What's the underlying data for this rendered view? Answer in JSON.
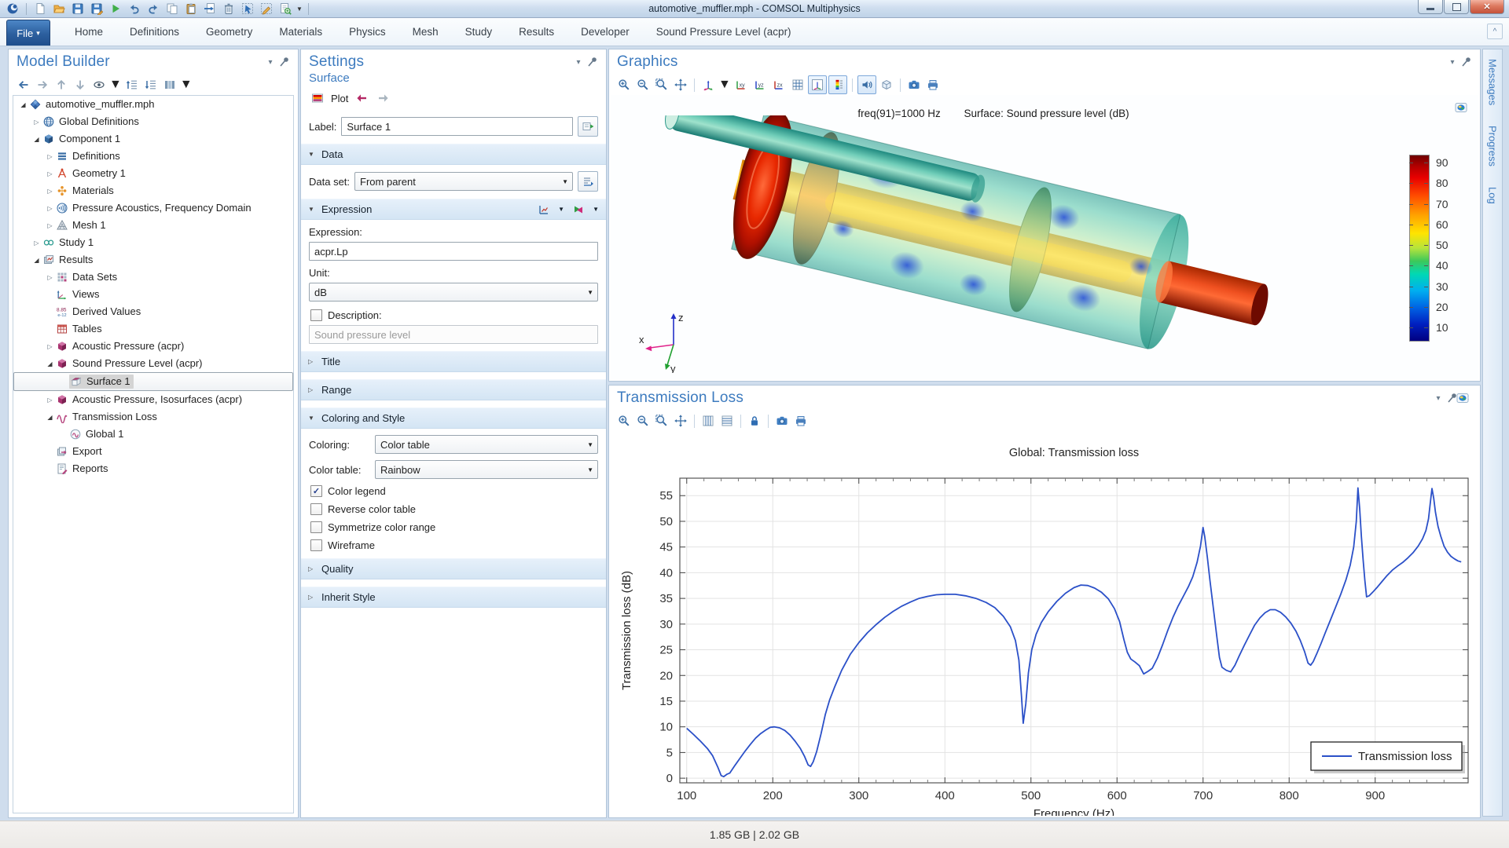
{
  "window": {
    "title": "automotive_muffler.mph - COMSOL Multiphysics",
    "quick_access_icons": [
      "comsol-logo",
      "new",
      "open",
      "save",
      "save-as",
      "run",
      "undo",
      "redo",
      "copy",
      "paste",
      "insert",
      "delete",
      "select",
      "clear-selection",
      "find"
    ]
  },
  "ribbon": {
    "file_label": "File",
    "tabs": [
      "Home",
      "Definitions",
      "Geometry",
      "Materials",
      "Physics",
      "Mesh",
      "Study",
      "Results",
      "Developer",
      "Sound Pressure Level (acpr)"
    ]
  },
  "model_builder": {
    "title": "Model Builder",
    "toolbar": [
      {
        "icon": "go-back"
      },
      {
        "icon": "go-forward"
      },
      {
        "icon": "move-up"
      },
      {
        "icon": "move-down"
      },
      {
        "icon": "show",
        "caret": true
      },
      {
        "icon": "collapse-all"
      },
      {
        "icon": "expand-all"
      },
      {
        "icon": "model-tree-node-text",
        "caret": true
      }
    ],
    "tree": [
      {
        "label": "automotive_muffler.mph",
        "icon": "model",
        "level": 0,
        "state": "expanded"
      },
      {
        "label": "Global Definitions",
        "icon": "globe",
        "level": 1,
        "state": "collapsed"
      },
      {
        "label": "Component 1",
        "icon": "component",
        "level": 1,
        "state": "expanded"
      },
      {
        "label": "Definitions",
        "icon": "definitions",
        "level": 2,
        "state": "collapsed"
      },
      {
        "label": "Geometry 1",
        "icon": "geometry",
        "level": 2,
        "state": "collapsed"
      },
      {
        "label": "Materials",
        "icon": "materials",
        "level": 2,
        "state": "collapsed"
      },
      {
        "label": "Pressure Acoustics, Frequency Domain",
        "icon": "physics",
        "level": 2,
        "state": "collapsed"
      },
      {
        "label": "Mesh 1",
        "icon": "mesh",
        "level": 2,
        "state": "collapsed"
      },
      {
        "label": "Study 1",
        "icon": "study",
        "level": 1,
        "state": "collapsed"
      },
      {
        "label": "Results",
        "icon": "results",
        "level": 1,
        "state": "expanded"
      },
      {
        "label": "Data Sets",
        "icon": "datasets",
        "level": 2,
        "state": "collapsed"
      },
      {
        "label": "Views",
        "icon": "views",
        "level": 2,
        "state": "none"
      },
      {
        "label": "Derived Values",
        "icon": "derived",
        "level": 2,
        "state": "none"
      },
      {
        "label": "Tables",
        "icon": "tables",
        "level": 2,
        "state": "none"
      },
      {
        "label": "Acoustic Pressure (acpr)",
        "icon": "group3d",
        "level": 2,
        "state": "collapsed"
      },
      {
        "label": "Sound Pressure Level (acpr)",
        "icon": "group3d",
        "level": 2,
        "state": "expanded"
      },
      {
        "label": "Surface 1",
        "icon": "surface",
        "level": 3,
        "state": "none",
        "selected": true
      },
      {
        "label": "Acoustic Pressure, Isosurfaces (acpr)",
        "icon": "group3d",
        "level": 2,
        "state": "collapsed"
      },
      {
        "label": "Transmission Loss",
        "icon": "group1d",
        "level": 2,
        "state": "expanded"
      },
      {
        "label": "Global 1",
        "icon": "global1",
        "level": 3,
        "state": "none"
      },
      {
        "label": "Export",
        "icon": "export",
        "level": 2,
        "state": "none"
      },
      {
        "label": "Reports",
        "icon": "reports",
        "level": 2,
        "state": "none"
      }
    ]
  },
  "settings": {
    "title": "Settings",
    "subtitle": "Surface",
    "plot_button": "Plot",
    "label_field": {
      "label": "Label:",
      "value": "Surface 1"
    },
    "sections": {
      "data": "Data",
      "expression": "Expression",
      "title": "Title",
      "range": "Range",
      "coloring": "Coloring and Style",
      "quality": "Quality",
      "inherit": "Inherit Style"
    },
    "data_set": {
      "label": "Data set:",
      "value": "From parent"
    },
    "expression_field": {
      "label": "Expression:",
      "value": "acpr.Lp"
    },
    "unit_field": {
      "label": "Unit:",
      "value": "dB"
    },
    "description_field": {
      "label": "Description:",
      "value": "Sound pressure level",
      "checked": false
    },
    "coloring_rows": [
      {
        "label": "Coloring:",
        "value": "Color table"
      },
      {
        "label": "Color table:",
        "value": "Rainbow"
      }
    ],
    "checkboxes": [
      {
        "label": "Color legend",
        "checked": true
      },
      {
        "label": "Reverse color table",
        "checked": false
      },
      {
        "label": "Symmetrize color range",
        "checked": false
      },
      {
        "label": "Wireframe",
        "checked": false
      }
    ]
  },
  "graphics": {
    "title": "Graphics",
    "toolbar": [
      {
        "icon": "zoom-in"
      },
      {
        "icon": "zoom-out"
      },
      {
        "icon": "zoom-box"
      },
      {
        "icon": "zoom-extents"
      },
      {
        "sep": true
      },
      {
        "icon": "orientation",
        "caret": true
      },
      {
        "icon": "view-xy"
      },
      {
        "icon": "view-yz"
      },
      {
        "icon": "view-zx"
      },
      {
        "icon": "grid"
      },
      {
        "icon": "scene-axes",
        "active": true
      },
      {
        "icon": "color-legend",
        "active": true
      },
      {
        "sep": true
      },
      {
        "icon": "sound",
        "active": true
      },
      {
        "icon": "transparency"
      },
      {
        "sep": true
      },
      {
        "icon": "snapshot"
      },
      {
        "icon": "print"
      }
    ],
    "plot_annotation": {
      "freq": "freq(91)=1000 Hz",
      "surface": "Surface: Sound pressure level (dB)"
    },
    "colorbar": {
      "labels": [
        90,
        80,
        70,
        60,
        50,
        40,
        30,
        20,
        10
      ]
    },
    "axes_labels": {
      "x": "x",
      "y": "y",
      "z": "z"
    }
  },
  "transmission_loss": {
    "title": "Transmission Loss",
    "toolbar": [
      {
        "icon": "zoom-in"
      },
      {
        "icon": "zoom-out"
      },
      {
        "icon": "zoom-box"
      },
      {
        "icon": "zoom-extents"
      },
      {
        "sep": true
      },
      {
        "icon": "x-grid"
      },
      {
        "icon": "y-grid"
      },
      {
        "sep": true
      },
      {
        "icon": "lock"
      },
      {
        "sep": true
      },
      {
        "icon": "snapshot"
      },
      {
        "icon": "print"
      }
    ]
  },
  "chart_data": {
    "type": "line",
    "title": "Global: Transmission loss",
    "xlabel": "Frequency (Hz)",
    "ylabel": "Transmission loss (dB)",
    "xlim": [
      92,
      1008
    ],
    "ylim": [
      -0.9,
      58.4
    ],
    "x_ticks": [
      100,
      200,
      300,
      400,
      500,
      600,
      700,
      800,
      900
    ],
    "y_ticks": [
      0,
      5,
      10,
      15,
      20,
      25,
      30,
      35,
      40,
      45,
      50,
      55
    ],
    "x_minor_step": 20,
    "grid": true,
    "legend": {
      "position": "bottom-right",
      "entries": [
        "Transmission loss"
      ]
    },
    "series": [
      {
        "name": "Transmission loss",
        "color": "#2b50c8",
        "points": [
          [
            100,
            9.7
          ],
          [
            108,
            8.5
          ],
          [
            116,
            7.2
          ],
          [
            124,
            5.8
          ],
          [
            130,
            4.4
          ],
          [
            136,
            2.2
          ],
          [
            140,
            0.5
          ],
          [
            143,
            0.3
          ],
          [
            147,
            0.8
          ],
          [
            150,
            1.0
          ],
          [
            156,
            2.5
          ],
          [
            162,
            3.9
          ],
          [
            168,
            5.3
          ],
          [
            174,
            6.6
          ],
          [
            180,
            7.8
          ],
          [
            186,
            8.7
          ],
          [
            192,
            9.4
          ],
          [
            197,
            9.9
          ],
          [
            202,
            10.0
          ],
          [
            208,
            9.8
          ],
          [
            214,
            9.3
          ],
          [
            220,
            8.4
          ],
          [
            226,
            7.2
          ],
          [
            232,
            5.8
          ],
          [
            237,
            4.2
          ],
          [
            241,
            2.6
          ],
          [
            244,
            2.3
          ],
          [
            247,
            3.2
          ],
          [
            251,
            5.2
          ],
          [
            256,
            8.6
          ],
          [
            261,
            12.4
          ],
          [
            266,
            15.2
          ],
          [
            272,
            17.8
          ],
          [
            280,
            21.0
          ],
          [
            290,
            24.1
          ],
          [
            300,
            26.4
          ],
          [
            310,
            28.3
          ],
          [
            320,
            29.9
          ],
          [
            330,
            31.3
          ],
          [
            340,
            32.5
          ],
          [
            350,
            33.5
          ],
          [
            360,
            34.3
          ],
          [
            370,
            35.0
          ],
          [
            380,
            35.4
          ],
          [
            390,
            35.7
          ],
          [
            400,
            35.8
          ],
          [
            412,
            35.8
          ],
          [
            424,
            35.5
          ],
          [
            436,
            35.0
          ],
          [
            448,
            34.2
          ],
          [
            458,
            33.2
          ],
          [
            468,
            31.5
          ],
          [
            476,
            29.5
          ],
          [
            482,
            26.8
          ],
          [
            486,
            23.0
          ],
          [
            489,
            16.0
          ],
          [
            491,
            10.7
          ],
          [
            494,
            14.5
          ],
          [
            497,
            20.5
          ],
          [
            501,
            25.0
          ],
          [
            506,
            28.0
          ],
          [
            512,
            30.3
          ],
          [
            520,
            32.4
          ],
          [
            530,
            34.4
          ],
          [
            540,
            36.0
          ],
          [
            550,
            37.1
          ],
          [
            558,
            37.6
          ],
          [
            566,
            37.5
          ],
          [
            574,
            37.0
          ],
          [
            582,
            36.2
          ],
          [
            590,
            34.9
          ],
          [
            597,
            33.0
          ],
          [
            603,
            30.5
          ],
          [
            608,
            27.0
          ],
          [
            612,
            24.5
          ],
          [
            616,
            23.2
          ],
          [
            621,
            22.6
          ],
          [
            626,
            21.9
          ],
          [
            631,
            20.3
          ],
          [
            636,
            20.8
          ],
          [
            641,
            21.4
          ],
          [
            647,
            23.4
          ],
          [
            653,
            26.0
          ],
          [
            659,
            28.8
          ],
          [
            665,
            31.3
          ],
          [
            671,
            33.5
          ],
          [
            677,
            35.4
          ],
          [
            683,
            37.3
          ],
          [
            688,
            39.2
          ],
          [
            693,
            42.0
          ],
          [
            697,
            45.2
          ],
          [
            700,
            48.8
          ],
          [
            702,
            47.0
          ],
          [
            705,
            43.0
          ],
          [
            708,
            38.5
          ],
          [
            712,
            33.0
          ],
          [
            716,
            27.5
          ],
          [
            719,
            23.5
          ],
          [
            722,
            21.6
          ],
          [
            727,
            21.0
          ],
          [
            732,
            20.7
          ],
          [
            737,
            22.0
          ],
          [
            742,
            23.8
          ],
          [
            748,
            25.9
          ],
          [
            754,
            27.9
          ],
          [
            760,
            29.8
          ],
          [
            766,
            31.2
          ],
          [
            772,
            32.2
          ],
          [
            778,
            32.8
          ],
          [
            784,
            32.8
          ],
          [
            790,
            32.3
          ],
          [
            796,
            31.4
          ],
          [
            802,
            30.2
          ],
          [
            808,
            28.6
          ],
          [
            813,
            26.8
          ],
          [
            818,
            24.6
          ],
          [
            822,
            22.4
          ],
          [
            825,
            22.0
          ],
          [
            828,
            22.7
          ],
          [
            832,
            24.2
          ],
          [
            837,
            26.2
          ],
          [
            842,
            28.3
          ],
          [
            848,
            30.8
          ],
          [
            854,
            33.3
          ],
          [
            860,
            35.8
          ],
          [
            866,
            38.6
          ],
          [
            871,
            41.5
          ],
          [
            875,
            45.0
          ],
          [
            878,
            50.0
          ],
          [
            880,
            56.5
          ],
          [
            882,
            52.5
          ],
          [
            884,
            47.0
          ],
          [
            886,
            42.5
          ],
          [
            888,
            38.5
          ],
          [
            890,
            35.3
          ],
          [
            893,
            35.5
          ],
          [
            897,
            36.2
          ],
          [
            902,
            37.1
          ],
          [
            908,
            38.3
          ],
          [
            914,
            39.5
          ],
          [
            920,
            40.5
          ],
          [
            926,
            41.3
          ],
          [
            932,
            42.0
          ],
          [
            938,
            42.9
          ],
          [
            944,
            43.9
          ],
          [
            950,
            45.2
          ],
          [
            955,
            46.6
          ],
          [
            959,
            48.2
          ],
          [
            962,
            50.5
          ],
          [
            964,
            53.5
          ],
          [
            966,
            56.4
          ],
          [
            968,
            54.5
          ],
          [
            970,
            51.8
          ],
          [
            973,
            49.0
          ],
          [
            976,
            47.2
          ],
          [
            980,
            45.2
          ],
          [
            984,
            44.0
          ],
          [
            988,
            43.2
          ],
          [
            992,
            42.7
          ],
          [
            996,
            42.3
          ],
          [
            1000,
            42.1
          ]
        ]
      }
    ]
  },
  "sidebar_tabs": [
    "Messages",
    "Progress",
    "Log"
  ],
  "status_bar": {
    "memory": "1.85 GB | 2.02 GB"
  },
  "colors": {
    "accent": "#3d7bbf",
    "selection": "#d4d4d4",
    "chart_line": "#2b50c8",
    "file_button": "#2c5f9e"
  }
}
